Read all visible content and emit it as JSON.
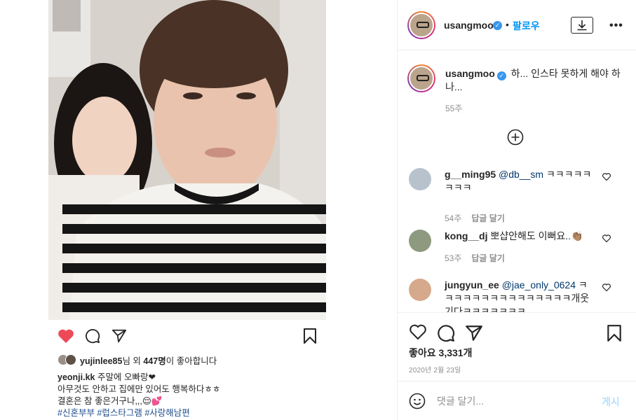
{
  "embedded_post": {
    "likes_user": "yujinlee85",
    "likes_mid": "님 외 ",
    "likes_count": "447명",
    "likes_suffix": "이 좋아합니다",
    "caption_user": "yeonji.kk",
    "caption_line1": " 주말에 오빠랑❤",
    "caption_line2": "아무것도 안하고 집에만 있어도 행복하다ㅎㅎ",
    "caption_line3": "결혼은 참 좋은거구나,,,😌💕",
    "hashtags": "#신혼부부 #럽스타그램 #사랑해남편",
    "liked_color": "#ed4956"
  },
  "header": {
    "username": "usangmoo",
    "verified_icon": "verified-badge-icon",
    "separator": "•",
    "follow_label": "팔로우",
    "download_icon": "download-icon",
    "more_icon": "more-options-icon"
  },
  "caption": {
    "username": "usangmoo",
    "text": " 하... 인스타 못하게 해야 하나...",
    "time": "55주"
  },
  "load_more_icon": "plus-circle-icon",
  "comments": [
    {
      "username": "g__ming95",
      "mention": "@db__sm",
      "text": " ㅋㅋㅋㅋㅋㅋㅋㅋ",
      "time": "54주",
      "reply": "답글 달기"
    },
    {
      "username": "kong__dj",
      "mention": "",
      "text": " 뽀샵안해도 이뻐요..👏🏽",
      "time": "53주",
      "reply": "답글 달기"
    },
    {
      "username": "jungyun_ee",
      "mention": "@jae_only_0624",
      "text": " ㅋㅋㅋㅋㅋㅋㅋㅋㅋㅋㅋㅋㅋㅋㅋ개웃기다ㅋㅋㅋㅋㅋㅋㅋ",
      "time": "",
      "reply": ""
    }
  ],
  "actions": {
    "likes": "좋아요 3,331개",
    "date": "2020년 2월 23일"
  },
  "comment_box": {
    "placeholder": "댓글 달기...",
    "post_label": "게시",
    "post_color": "#b2dffc"
  }
}
